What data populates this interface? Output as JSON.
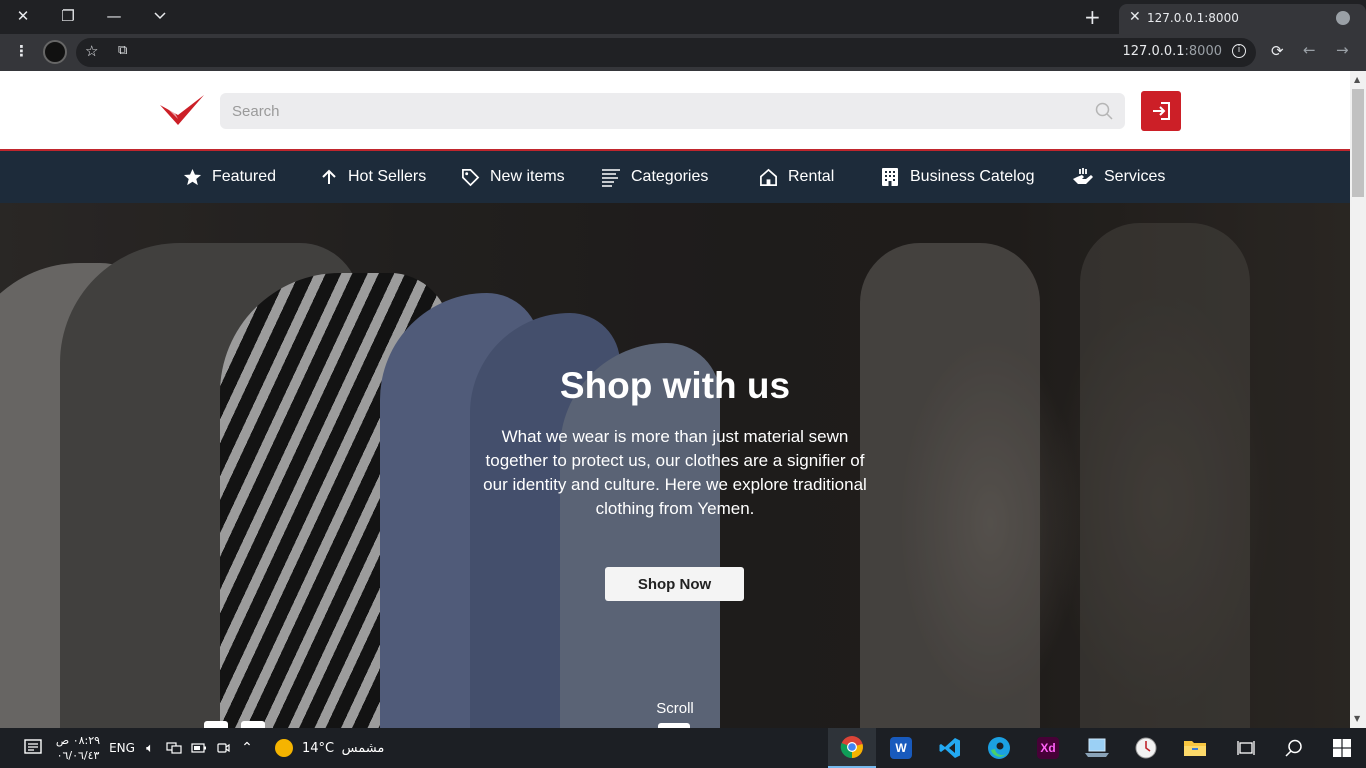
{
  "browser": {
    "tab_title": "127.0.0.1:8000",
    "url_host": "127.0.0.1",
    "url_port": ":8000",
    "accent": "#35363a"
  },
  "site": {
    "brand_color": "#cc1f27",
    "nav_bg": "#1d2b3a",
    "search": {
      "placeholder": "Search"
    },
    "nav": [
      {
        "label": "Featured",
        "icon": "star-icon"
      },
      {
        "label": "Hot Sellers",
        "icon": "arrow-up-icon"
      },
      {
        "label": "New items",
        "icon": "tag-icon"
      },
      {
        "label": "Categories",
        "icon": "list-icon"
      },
      {
        "label": "Rental",
        "icon": "home-icon"
      },
      {
        "label": "Business Catelog",
        "icon": "building-icon"
      },
      {
        "label": "Services",
        "icon": "hands-icon"
      }
    ],
    "hero": {
      "title": "Shop with us",
      "text": "What we wear is more than just material sewn together to protect us, our clothes are a signifier of our identity and culture. Here we explore traditional clothing from Yemen.",
      "button": "Shop Now",
      "scroll": "Scroll"
    }
  },
  "taskbar": {
    "time": "٠٨:٢٩ ص",
    "date": "٠٦/٠٦/٤٣",
    "language": "ENG",
    "temperature": "14°C",
    "weather": "مشمس",
    "apps": [
      "chrome-icon",
      "word-icon",
      "vscode-icon",
      "edge-icon",
      "xd-icon",
      "laptop-icon",
      "clock-icon",
      "folder-icon"
    ]
  }
}
